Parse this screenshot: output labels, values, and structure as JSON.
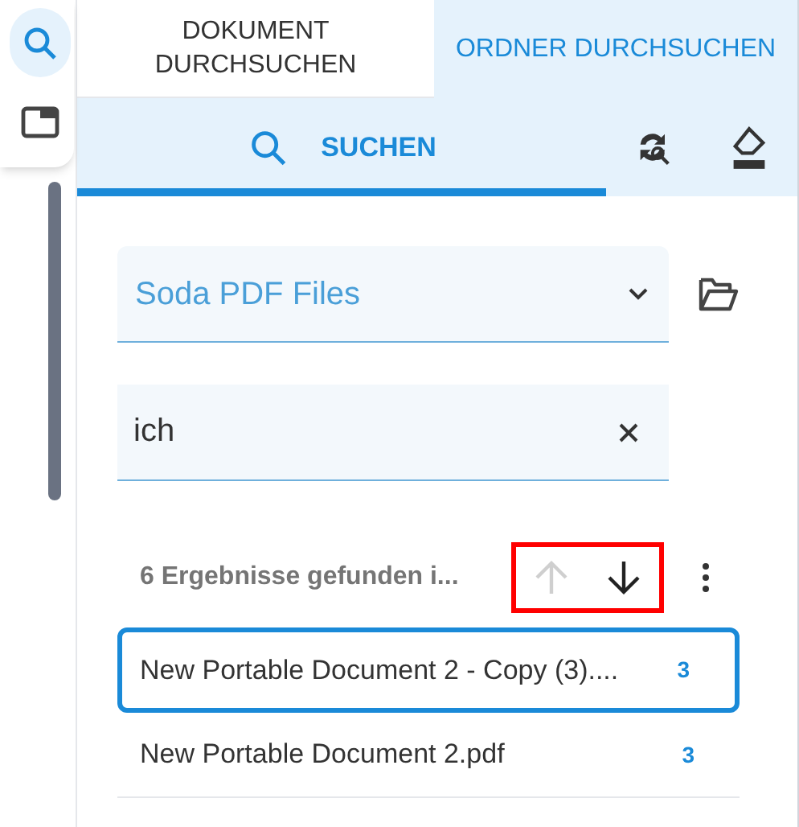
{
  "rail": {
    "items": [
      {
        "kind": "search",
        "selected": true
      },
      {
        "kind": "panel",
        "selected": false
      }
    ]
  },
  "tabs": [
    {
      "label": "DOKUMENT DURCHSUCHEN",
      "selected": false
    },
    {
      "label": "ORDNER DURCHSUCHEN",
      "selected": true
    }
  ],
  "toolbar": {
    "search_tab": {
      "label": "SUCHEN",
      "selected": true
    }
  },
  "folder": {
    "value": "Soda PDF Files"
  },
  "search": {
    "value": "ich"
  },
  "results": {
    "summary": "6 Ergebnisse gefunden i...",
    "nav": [
      {
        "kind": "up",
        "disabled": true
      },
      {
        "kind": "down",
        "disabled": false
      }
    ],
    "highlighted": true,
    "items": [
      {
        "name": "New Portable Document 2 - Copy (3)....",
        "count": "3",
        "selected": true
      },
      {
        "name": "New Portable Document 2.pdf",
        "count": "3",
        "selected": false
      }
    ]
  }
}
